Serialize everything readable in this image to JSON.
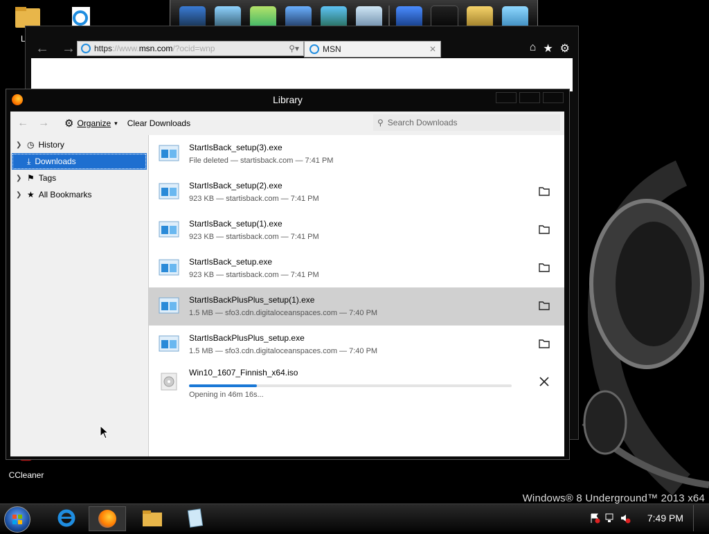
{
  "desktop": {
    "icons": [
      {
        "label": "Libr",
        "icon": "libraries-folder-icon"
      },
      {
        "label": "",
        "icon": "internet-explorer-icon"
      },
      {
        "label": "CCleaner",
        "icon": "ccleaner-icon"
      }
    ],
    "branding": "Windows® 8 Underground™ 2013 x64"
  },
  "dock": {
    "items": [
      "computer-icon",
      "network-icon",
      "library-icon",
      "media-player-icon",
      "photos-icon",
      "disc-icon",
      "globe-icon",
      "user-icon",
      "tools-icon",
      "recycle-bin-icon"
    ]
  },
  "browser": {
    "address_prefix": "https",
    "address_faded_1": "://www.",
    "address_domain": "msn.com",
    "address_faded_2": "/?ocid=wnp",
    "tab_title": "MSN"
  },
  "library": {
    "title": "Library",
    "toolbar": {
      "organize_label": "Organize",
      "clear_label": "Clear Downloads",
      "search_placeholder": "Search Downloads"
    },
    "sidebar": [
      {
        "label": "History",
        "icon": "clock-icon",
        "expandable": true
      },
      {
        "label": "Downloads",
        "icon": "download-icon",
        "expandable": false,
        "selected": true
      },
      {
        "label": "Tags",
        "icon": "tag-icon",
        "expandable": true
      },
      {
        "label": "All Bookmarks",
        "icon": "star-icon",
        "expandable": true
      }
    ],
    "downloads": [
      {
        "name": "StartIsBack_setup(3).exe",
        "status": "File deleted — startisback.com — 7:41 PM",
        "action": "none"
      },
      {
        "name": "StartIsBack_setup(2).exe",
        "status": "923 KB — startisback.com — 7:41 PM",
        "action": "folder"
      },
      {
        "name": "StartIsBack_setup(1).exe",
        "status": "923 KB — startisback.com — 7:41 PM",
        "action": "folder"
      },
      {
        "name": "StartIsBack_setup.exe",
        "status": "923 KB — startisback.com — 7:41 PM",
        "action": "folder"
      },
      {
        "name": "StartIsBackPlusPlus_setup(1).exe",
        "status": "1.5 MB — sfo3.cdn.digitaloceanspaces.com — 7:40 PM",
        "action": "folder",
        "highlight": true
      },
      {
        "name": "StartIsBackPlusPlus_setup.exe",
        "status": "1.5 MB — sfo3.cdn.digitaloceanspaces.com — 7:40 PM",
        "action": "folder"
      },
      {
        "name": "Win10_1607_Finnish_x64.iso",
        "status": "Opening in 46m 16s...",
        "action": "cancel",
        "progress": 0.21
      }
    ]
  },
  "taskbar": {
    "apps": [
      "internet-explorer-icon",
      "firefox-icon",
      "file-explorer-icon",
      "notepad-icon"
    ],
    "tray": [
      "action-center-flag-icon",
      "network-icon",
      "volume-muted-icon"
    ],
    "time": "7:49 PM"
  },
  "colors": {
    "accent": "#1e6fd0",
    "progress": "#1a78d6",
    "highlight_row": "#d0d0d0"
  }
}
